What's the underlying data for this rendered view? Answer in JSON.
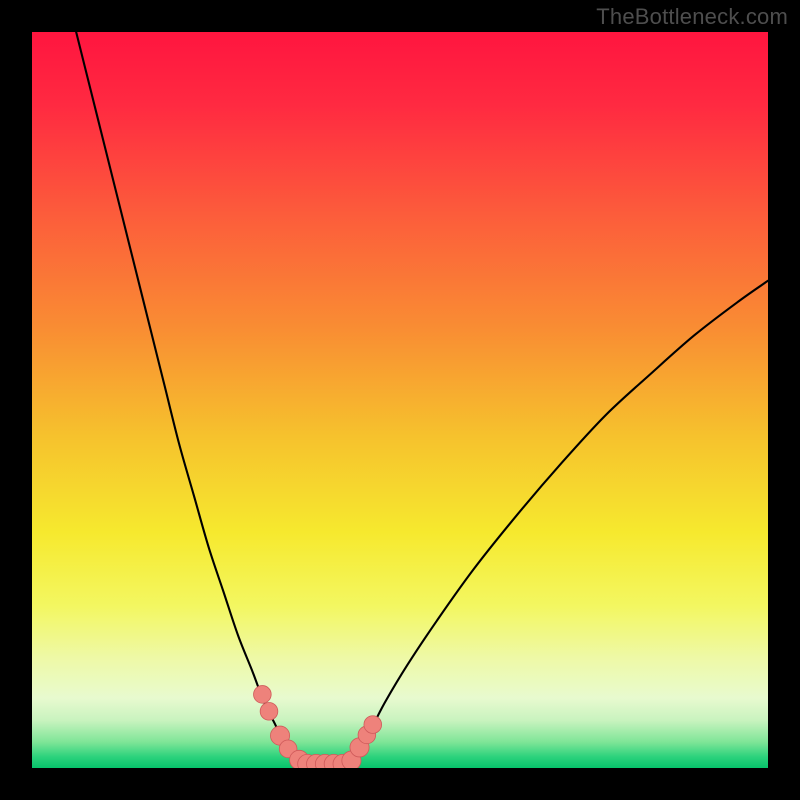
{
  "watermark": {
    "text": "TheBottleneck.com"
  },
  "colors": {
    "frame": "#000000",
    "curve": "#000000",
    "marker_fill": "#ee827b",
    "marker_stroke": "#cf5a5a",
    "gradient_stops": [
      {
        "offset": 0.0,
        "color": "#ff153f"
      },
      {
        "offset": 0.1,
        "color": "#ff2a41"
      },
      {
        "offset": 0.25,
        "color": "#fc5d3b"
      },
      {
        "offset": 0.4,
        "color": "#f98c33"
      },
      {
        "offset": 0.55,
        "color": "#f6c22d"
      },
      {
        "offset": 0.68,
        "color": "#f6e92e"
      },
      {
        "offset": 0.78,
        "color": "#f3f761"
      },
      {
        "offset": 0.85,
        "color": "#eef9a6"
      },
      {
        "offset": 0.905,
        "color": "#e8facf"
      },
      {
        "offset": 0.935,
        "color": "#c9f3bf"
      },
      {
        "offset": 0.965,
        "color": "#7ee597"
      },
      {
        "offset": 0.985,
        "color": "#2bd27c"
      },
      {
        "offset": 1.0,
        "color": "#07c36b"
      }
    ]
  },
  "chart_data": {
    "type": "line",
    "title": "",
    "xlabel": "",
    "ylabel": "",
    "xlim": [
      0,
      100
    ],
    "ylim": [
      0,
      100
    ],
    "left_curve": {
      "x": [
        6,
        8,
        10,
        12,
        14,
        16,
        18,
        20,
        22,
        24,
        26,
        28,
        30,
        31.5,
        33,
        34,
        35,
        36,
        37
      ],
      "y": [
        100,
        92,
        84,
        76,
        68,
        60,
        52,
        44,
        37,
        30,
        24,
        18,
        13,
        9,
        6,
        3.8,
        2.2,
        1.2,
        0.6
      ]
    },
    "right_curve": {
      "x": [
        43,
        44,
        46,
        48,
        51,
        55,
        60,
        66,
        72,
        78,
        84,
        90,
        96,
        100
      ],
      "y": [
        0.6,
        2.0,
        5.2,
        9.0,
        14,
        20,
        27,
        34.5,
        41.5,
        48,
        53.5,
        58.8,
        63.4,
        66.2
      ]
    },
    "flat_bottom": {
      "x_start": 37,
      "x_end": 43,
      "y": 0.55
    },
    "markers": [
      {
        "x": 31.3,
        "y": 10.0,
        "r": 1.2
      },
      {
        "x": 32.2,
        "y": 7.7,
        "r": 1.2
      },
      {
        "x": 33.7,
        "y": 4.4,
        "r": 1.3
      },
      {
        "x": 34.8,
        "y": 2.6,
        "r": 1.2
      },
      {
        "x": 36.3,
        "y": 1.1,
        "r": 1.3
      },
      {
        "x": 37.4,
        "y": 0.55,
        "r": 1.3
      },
      {
        "x": 38.6,
        "y": 0.55,
        "r": 1.3
      },
      {
        "x": 39.8,
        "y": 0.55,
        "r": 1.3
      },
      {
        "x": 41.0,
        "y": 0.55,
        "r": 1.3
      },
      {
        "x": 42.2,
        "y": 0.55,
        "r": 1.3
      },
      {
        "x": 43.4,
        "y": 1.0,
        "r": 1.3
      },
      {
        "x": 44.5,
        "y": 2.8,
        "r": 1.3
      },
      {
        "x": 45.5,
        "y": 4.5,
        "r": 1.2
      },
      {
        "x": 46.3,
        "y": 5.9,
        "r": 1.2
      }
    ]
  }
}
